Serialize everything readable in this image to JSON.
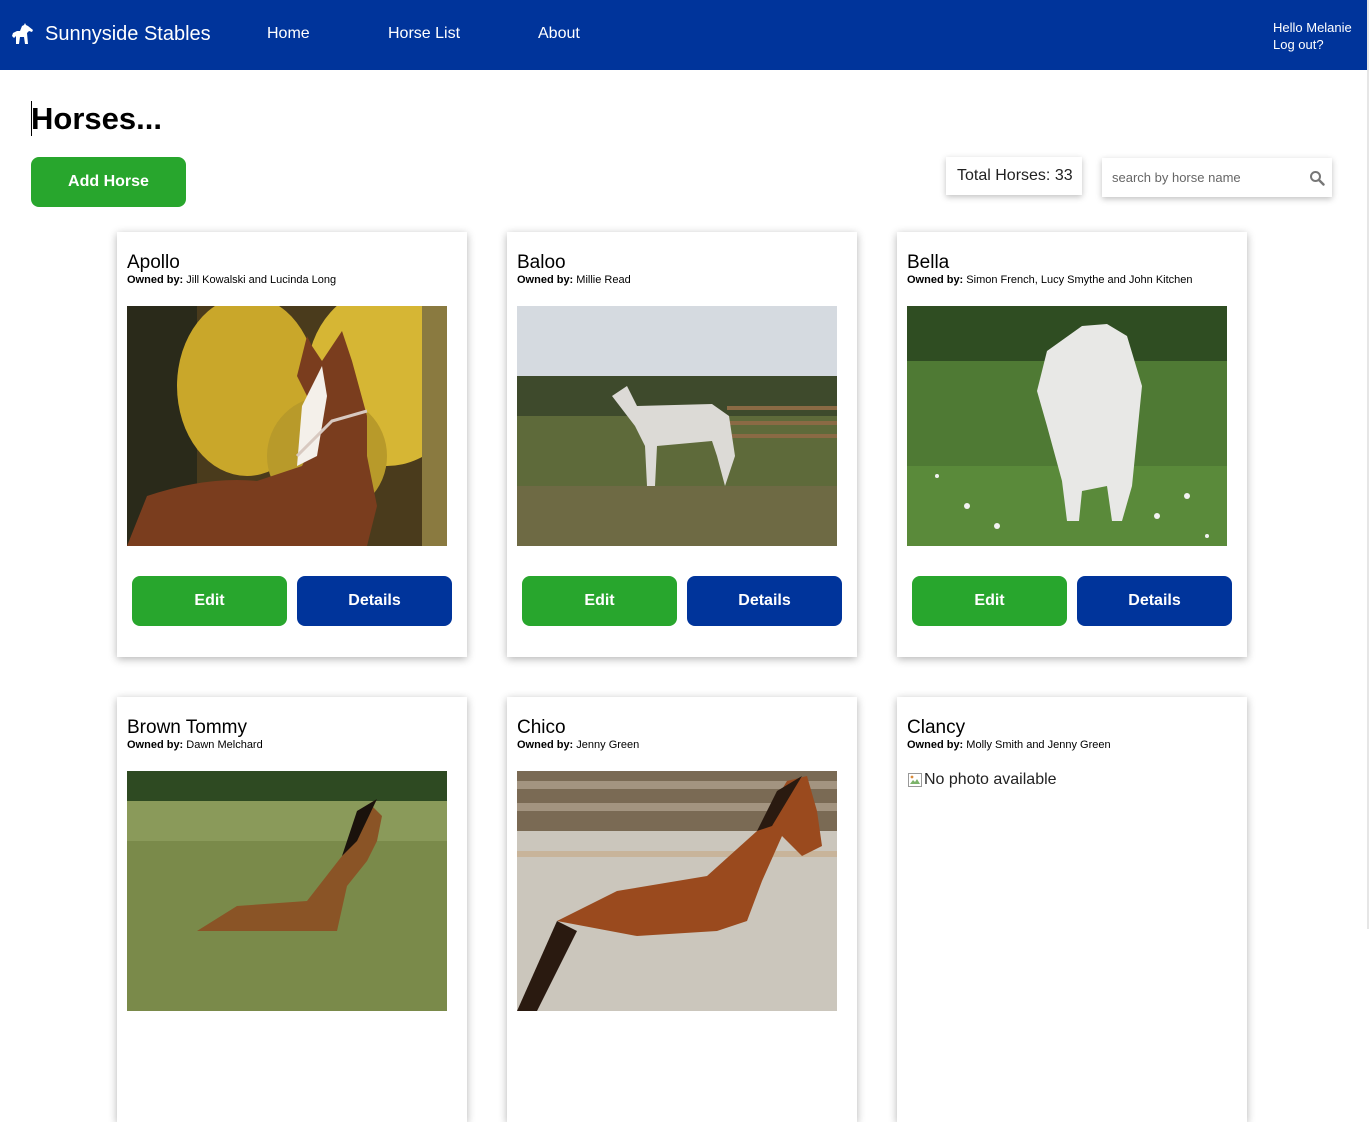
{
  "brand": {
    "name": "Sunnyside Stables",
    "icon": "horse-icon"
  },
  "nav": {
    "items": [
      {
        "label": "Home"
      },
      {
        "label": "Horse List"
      },
      {
        "label": "About"
      }
    ]
  },
  "user": {
    "greeting": "Hello Melanie",
    "logout": "Log out?"
  },
  "page": {
    "title": "Horses..."
  },
  "toolbar": {
    "add_label": "Add Horse",
    "total_label": "Total Horses: 33",
    "search_placeholder": "search by horse name",
    "search_icon": "search-icon"
  },
  "owned_prefix": "Owned by:",
  "no_photo_alt": "No photo available",
  "buttons": {
    "edit": "Edit",
    "details": "Details"
  },
  "colors": {
    "header": "#00349b",
    "primary_green": "#28a62d",
    "primary_blue": "#00349b"
  },
  "horses": [
    {
      "name": "Apollo",
      "owners": "Jill Kowalski and Lucinda Long",
      "photo": "chestnut horse with white blaze and rope halter, yellow autumn trees behind"
    },
    {
      "name": "Baloo",
      "owners": "Millie Read",
      "photo": "grey horse standing in a paddock with wooden fence"
    },
    {
      "name": "Bella",
      "owners": "Simon French, Lucy Smythe and John Kitchen",
      "photo": "white horse walking on grass with daisies"
    },
    {
      "name": "Brown Tommy",
      "owners": "Dawn Melchard",
      "photo": "bay pony on heathland"
    },
    {
      "name": "Chico",
      "owners": "Jenny Green",
      "photo": "bay horse trotting in a wooden arena"
    },
    {
      "name": "Clancy",
      "owners": "Molly Smith and Jenny Green",
      "photo": null
    }
  ]
}
